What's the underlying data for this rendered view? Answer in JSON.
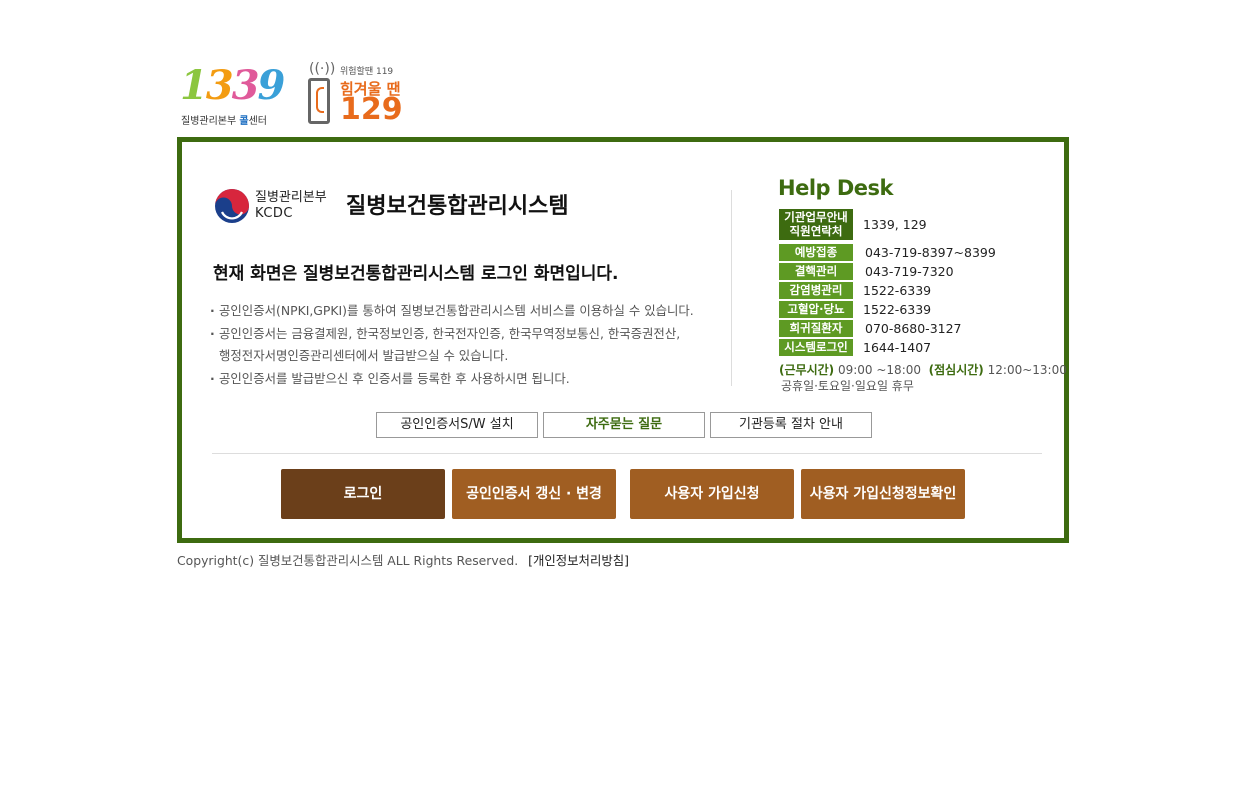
{
  "header": {
    "logo_1339": {
      "d1": "1",
      "d2": "3",
      "d3": "3",
      "d4": "9",
      "caption_prefix": "질병관리본부 ",
      "caption_bold": "콜",
      "caption_suffix": "센터"
    },
    "logo_129": {
      "small": "위험할땐 119",
      "mid": "힘겨울 땐",
      "big": "129"
    }
  },
  "org": {
    "name_ko": "질병관리본부",
    "name_en": "KCDC",
    "system_title": "질병보건통합관리시스템"
  },
  "login_heading": "현재 화면은 질병보건통합관리시스템 로그인 화면입니다.",
  "notices": [
    "공인인증서(NPKI,GPKI)를 통하여 질병보건통합관리시스템 서비스를 이용하실 수 있습니다.",
    "공인인증서는 금융결제원, 한국정보인증, 한국전자인증, 한국무역정보통신, 한국증권전산,",
    "행정전자서명인증관리센터에서 발급받으실 수 있습니다.",
    "공인인증서를 발급받으신 후 인증서를 등록한 후 사용하시면 됩니다."
  ],
  "helpdesk": {
    "title": "Help Desk",
    "rows": [
      {
        "label": "기관업무안내 직원연락처",
        "value": "1339, 129"
      },
      {
        "label": "예방접종",
        "value": "043-719-8397~8399"
      },
      {
        "label": "결핵관리",
        "value": "043-719-7320"
      },
      {
        "label": "감염병관리",
        "value": "1522-6339"
      },
      {
        "label": "고혈압·당뇨",
        "value": "1522-6339"
      },
      {
        "label": "희귀질환자",
        "value": "070-8680-3127"
      },
      {
        "label": "시스템로그인",
        "value": "1644-1407"
      }
    ],
    "work_label": "(근무시간)",
    "work_hours": "09:00 ~18:00",
    "lunch_label": "(점심시간)",
    "lunch_hours": "12:00~13:00",
    "holidays": "공휴일·토요일·일요일 휴무"
  },
  "links": {
    "install": "공인인증서S/W 설치",
    "faq": "자주묻는 질문",
    "register_guide": "기관등록 절차 안내"
  },
  "actions": {
    "login": "로그인",
    "renew": "공인인증서 갱신 · 변경",
    "signup": "사용자 가입신청",
    "signup_check": "사용자 가입신청정보확인"
  },
  "footer": {
    "copyright": "Copyright(c) 질병보건통합관리시스템 ALL Rights Reserved.",
    "privacy": "[개인정보처리방침]"
  },
  "colors": {
    "frame": "#3d6b10",
    "badge": "#5e9a23",
    "login_button": "#6b3f1a",
    "action_button": "#a05e22"
  }
}
